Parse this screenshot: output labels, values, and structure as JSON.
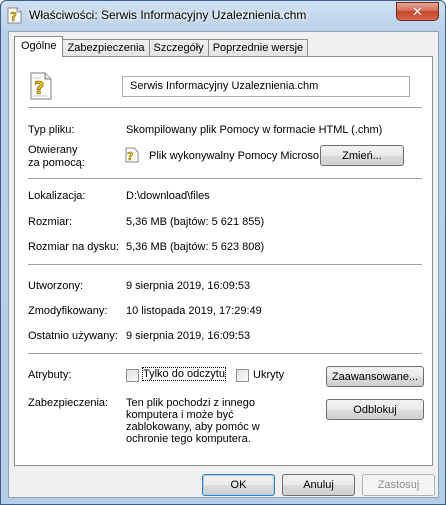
{
  "window": {
    "title": "Właściwości: Serwis Informacyjny Uzaleznienia.chm",
    "close_glyph": "✕"
  },
  "tabs": [
    {
      "label": "Ogólne",
      "active": true
    },
    {
      "label": "Zabezpieczenia",
      "active": false
    },
    {
      "label": "Szczegóły",
      "active": false
    },
    {
      "label": "Poprzednie wersje",
      "active": false
    }
  ],
  "general": {
    "file_icon": "chm-help-file-icon",
    "filename": "Serwis Informacyjny Uzaleznienia.chm",
    "type_label": "Typ pliku:",
    "type_value": "Skompilowany plik Pomocy w formacie HTML (.chm)",
    "opens_with_label_1": "Otwierany",
    "opens_with_label_2": "za pomocą:",
    "opens_with_value": "Plik wykonywalny Pomocy Microso",
    "change_button": "Zmień...",
    "location_label": "Lokalizacja:",
    "location_value": "D:\\download\\files",
    "size_label": "Rozmiar:",
    "size_value": "5,36 MB (bajtów: 5 621 855)",
    "size_on_disk_label": "Rozmiar na dysku:",
    "size_on_disk_value": "5,36 MB (bajtów: 5 623 808)",
    "created_label": "Utworzony:",
    "created_value": "9 sierpnia 2019, 16:09:53",
    "modified_label": "Zmodyfikowany:",
    "modified_value": "10 listopada 2019, 17:29:49",
    "accessed_label": "Ostatnio używany:",
    "accessed_value": "9 sierpnia 2019, 16:09:53",
    "attributes_label": "Atrybuty:",
    "readonly_label": "Tylko do odczytu",
    "readonly_checked": false,
    "hidden_label": "Ukryty",
    "hidden_checked": false,
    "advanced_button": "Zaawansowane...",
    "security_label": "Zabezpieczenia:",
    "security_text_1": "Ten plik pochodzi z innego",
    "security_text_2": "komputera i może być",
    "security_text_3": "zablokowany, aby pomóc w",
    "security_text_4": "ochronie tego komputera.",
    "unblock_button": "Odblokuj"
  },
  "footer": {
    "ok": "OK",
    "cancel": "Anuluj",
    "apply": "Zastosuj"
  }
}
